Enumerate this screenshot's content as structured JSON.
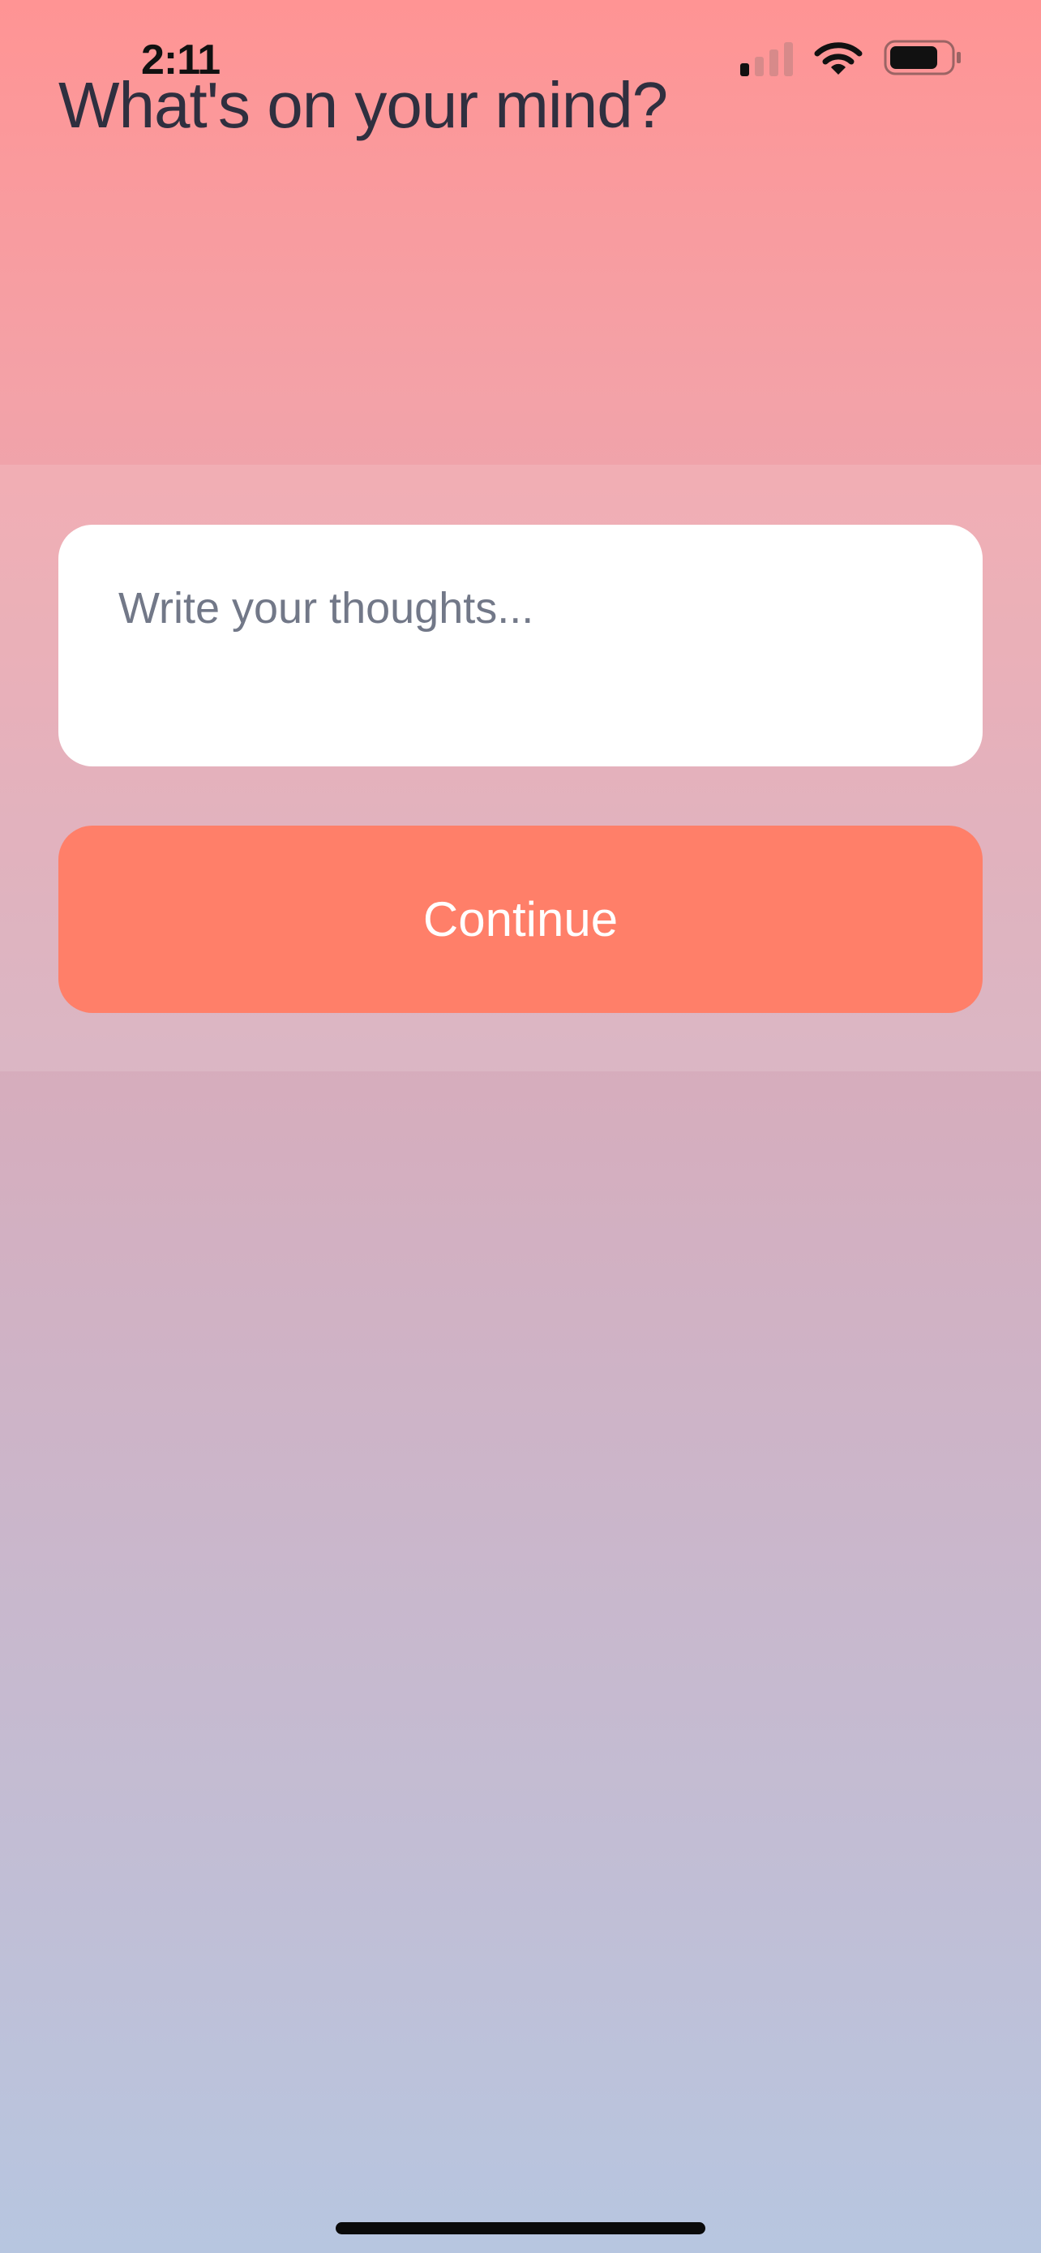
{
  "status_bar": {
    "time": "2:11",
    "signal_bars_active": 1,
    "signal_bars_total": 4,
    "battery_level": 0.75
  },
  "header": {
    "title": "What's on your mind?"
  },
  "entry": {
    "value": "",
    "placeholder": "Write your thoughts..."
  },
  "actions": {
    "continue_label": "Continue"
  },
  "colors": {
    "accent": "#ff7f69",
    "title_text": "#2f2f3f",
    "placeholder_text": "#727888",
    "gradient_top": "#ff9494",
    "gradient_bottom": "#b7c6e0"
  },
  "icons": {
    "signal": "cellular-signal-icon",
    "wifi": "wifi-icon",
    "battery": "battery-icon"
  }
}
